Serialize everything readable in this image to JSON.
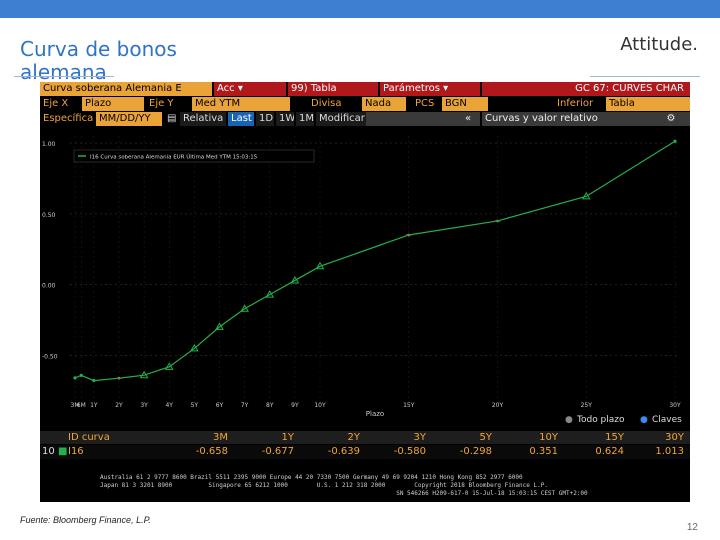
{
  "slide": {
    "title": "Curva de bonos alemana",
    "brand": "Attitude.",
    "source": "Fuente: Bloomberg Finance, L.P.",
    "page_number": "12"
  },
  "terminal": {
    "row1": {
      "title": "Curva soberana Alemania E",
      "acc": "Acc",
      "tabla": "99) Tabla",
      "parametros": "Parámetros",
      "right": "GC 67: CURVES CHAR"
    },
    "row2": {
      "eje_x_label": "Eje X",
      "eje_x_value": "Plazo",
      "eje_y_label": "Eje Y",
      "eje_y_value": "Med YTM",
      "divisa_label": "Divisa",
      "divisa_value": "Nada",
      "pcs_label": "PCS",
      "pcs_value": "BGN",
      "inferior_label": "Inferior",
      "inferior_value": "Tabla"
    },
    "row3": {
      "especifica": "Específica",
      "date": "MM/DD/YY",
      "relativa": "Relativa",
      "last": "Last",
      "tabs": [
        "1D",
        "1W",
        "1M"
      ],
      "modificar": "Modificar",
      "collapse": "«",
      "curvas": "Curvas y valor relativo"
    },
    "legend": {
      "todo_plazo": "Todo plazo",
      "claves": "Claves"
    },
    "table": {
      "headers": [
        "ID curva",
        "3M",
        "1Y",
        "2Y",
        "3Y",
        "5Y",
        "10Y",
        "15Y",
        "30Y"
      ],
      "row": {
        "num": "10",
        "id": "I16",
        "values": [
          "-0.658",
          "-0.677",
          "-0.639",
          "-0.580",
          "-0.298",
          "0.351",
          "0.624",
          "1.013"
        ]
      }
    },
    "footer": "Australia 61 2 9777 8600 Brazil 5511 2395 9000 Europe 44 20 7330 7500 Germany 49 69 9204 1210 Hong Kong 852 2977 6000\nJapan 81 3 3201 8900          Singapore 65 6212 1000        U.S. 1 212 318 2000        Copyright 2018 Bloomberg Finance L.P.\n                                                                                  SN 546266 H209-617-0 15-Jul-18 15:03:15 CEST GMT+2:00"
  },
  "chart_data": {
    "type": "line",
    "legend_label": "I16 Curva soberana Alemania EUR Última Med YTM 15:03:15",
    "xlabel": "Plazo",
    "ylabel": "",
    "x": [
      "3M",
      "6M",
      "1Y",
      "2Y",
      "3Y",
      "4Y",
      "5Y",
      "6Y",
      "7Y",
      "8Y",
      "9Y",
      "10Y",
      "15Y",
      "20Y",
      "25Y",
      "30Y"
    ],
    "series": [
      {
        "name": "I16",
        "values": [
          -0.658,
          -0.64,
          -0.677,
          -0.66,
          -0.639,
          -0.58,
          -0.45,
          -0.298,
          -0.17,
          -0.07,
          0.03,
          0.13,
          0.351,
          0.45,
          0.624,
          1.013
        ]
      }
    ],
    "yticks": [
      "1.00",
      "0.50",
      "0.00",
      "-0.50"
    ],
    "ylim": [
      -0.8,
      1.05
    ],
    "color": "#22b14c",
    "grid": true
  }
}
